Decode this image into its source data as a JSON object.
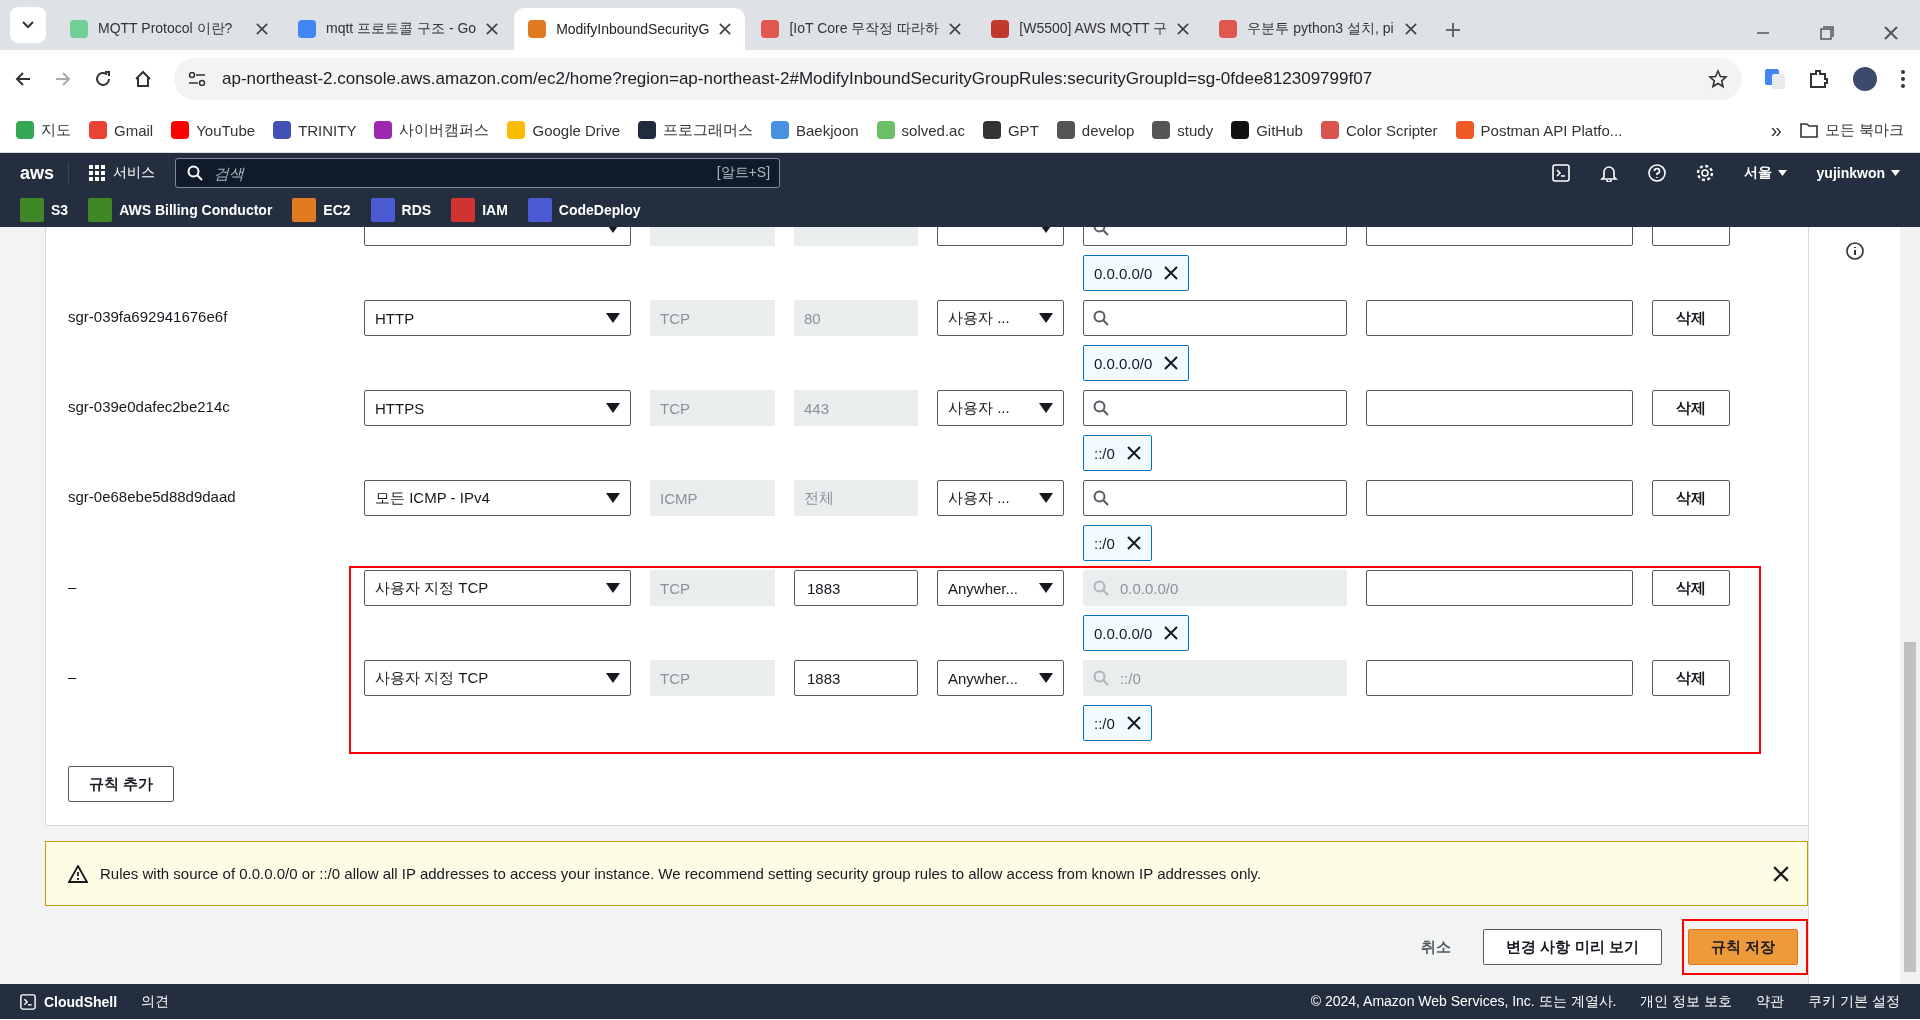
{
  "browser": {
    "tabs": [
      {
        "title": "MQTT Protocol 이란?",
        "selected": false,
        "color": "#6fcf97"
      },
      {
        "title": "mqtt 프로토콜 구조 - Go",
        "selected": false,
        "color": "#4285f4"
      },
      {
        "title": "ModifyInboundSecurityG",
        "selected": true,
        "color": "#e07b22"
      },
      {
        "title": "[IoT Core 무작정 따라하",
        "selected": false,
        "color": "#e0574f"
      },
      {
        "title": "[W5500] AWS MQTT 구",
        "selected": false,
        "color": "#c0392b"
      },
      {
        "title": "우분투 python3 설치, pi",
        "selected": false,
        "color": "#e0574f"
      }
    ],
    "url": "ap-northeast-2.console.aws.amazon.com/ec2/home?region=ap-northeast-2#ModifyInboundSecurityGroupRules:securityGroupId=sg-0fdee812309799f07",
    "bookmarks": [
      {
        "label": "지도",
        "color": "#34a853"
      },
      {
        "label": "Gmail",
        "color": "#ea4335"
      },
      {
        "label": "YouTube",
        "color": "#ff0000"
      },
      {
        "label": "TRINITY",
        "color": "#3f51b5"
      },
      {
        "label": "사이버캠퍼스",
        "color": "#9c27b0"
      },
      {
        "label": "Google Drive",
        "color": "#fbbc04"
      },
      {
        "label": "프로그래머스",
        "color": "#202b3d"
      },
      {
        "label": "Baekjoon",
        "color": "#4a90e2"
      },
      {
        "label": "solved.ac",
        "color": "#6dbf67"
      },
      {
        "label": "GPT",
        "color": "#333333"
      },
      {
        "label": "develop",
        "color": "#555555"
      },
      {
        "label": "study",
        "color": "#555555"
      },
      {
        "label": "GitHub",
        "color": "#111111"
      },
      {
        "label": "Color Scripter",
        "color": "#d9534f"
      },
      {
        "label": "Postman API Platfo...",
        "color": "#ef5b25"
      }
    ],
    "more": "»",
    "all_bookmarks": "모든 북마크"
  },
  "aws_nav": {
    "logo": "aws",
    "services": "서비스",
    "search_placeholder": "검색",
    "shortcut": "[알트+S]",
    "region": "서울",
    "user": "yujinkwon",
    "favorites": [
      {
        "label": "S3",
        "color": "#3f8624"
      },
      {
        "label": "AWS Billing Conductor",
        "color": "#3f8624"
      },
      {
        "label": "EC2",
        "color": "#e07b22"
      },
      {
        "label": "RDS",
        "color": "#4a5bd4"
      },
      {
        "label": "IAM",
        "color": "#d13232"
      },
      {
        "label": "CodeDeploy",
        "color": "#4a5bd4"
      }
    ]
  },
  "rule_groups": [
    {
      "highlighted": false,
      "rules": [
        {
          "port_editable": false,
          "search_disabled": false,
          "tag": "0.0.0.0/0"
        },
        {
          "id": "sgr-039fa692941676e6f",
          "type": "HTTP",
          "protocol": "TCP",
          "port": "80",
          "port_editable": false,
          "source": "사용자 ...",
          "search_disabled": false,
          "tag": "0.0.0.0/0",
          "delete": "삭제"
        },
        {
          "id": "sgr-039e0dafec2be214c",
          "type": "HTTPS",
          "protocol": "TCP",
          "port": "443",
          "port_editable": false,
          "source": "사용자 ...",
          "search_disabled": false,
          "tag": "::/0",
          "delete": "삭제"
        },
        {
          "id": "sgr-0e68ebe5d88d9daad",
          "type": "모든 ICMP - IPv4",
          "protocol": "ICMP",
          "port": "전체",
          "port_editable": false,
          "source": "사용자 ...",
          "search_disabled": false,
          "tag": "::/0",
          "delete": "삭제"
        }
      ]
    },
    {
      "highlighted": true,
      "rules": [
        {
          "id": "–",
          "type": "사용자 지정 TCP",
          "protocol": "TCP",
          "port": "1883",
          "port_editable": true,
          "source": "Anywher...",
          "search_value": "0.0.0.0/0",
          "search_disabled": true,
          "tag": "0.0.0.0/0",
          "delete": "삭제"
        },
        {
          "id": "–",
          "type": "사용자 지정 TCP",
          "protocol": "TCP",
          "port": "1883",
          "port_editable": true,
          "source": "Anywher...",
          "search_value": "::/0",
          "search_disabled": true,
          "tag": "::/0",
          "delete": "삭제"
        }
      ]
    }
  ],
  "add_rule": "규칙 추가",
  "warning": "Rules with source of 0.0.0.0/0 or ::/0 allow all IP addresses to access your instance. We recommend setting security group rules to allow access from known IP addresses only.",
  "actions": {
    "cancel": "취소",
    "preview": "변경 사항 미리 보기",
    "save": "규칙 저장",
    "save_highlighted": true
  },
  "footer": {
    "cloudshell": "CloudShell",
    "feedback": "의견",
    "copyright": "© 2024, Amazon Web Services, Inc. 또는 계열사.",
    "links": [
      "개인 정보 보호",
      "약관",
      "쿠키 기본 설정"
    ]
  }
}
